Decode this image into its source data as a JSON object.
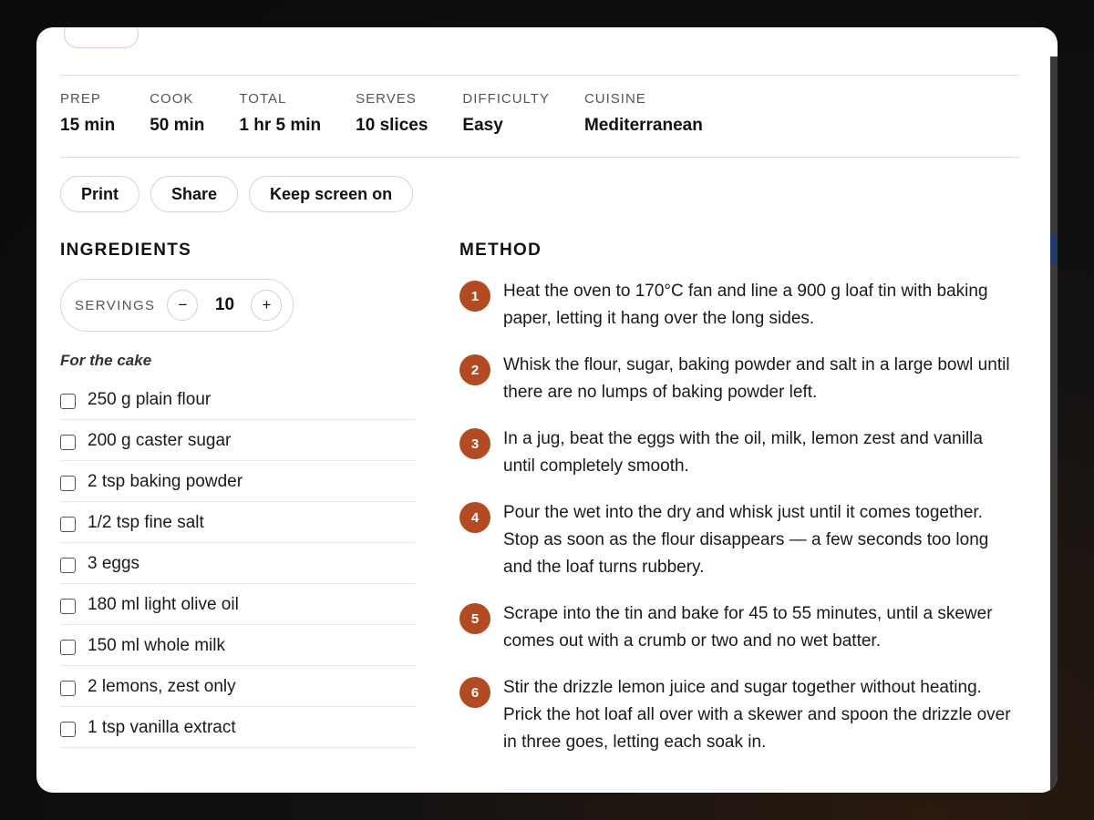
{
  "stats": [
    {
      "label": "PREP",
      "value": "15 min"
    },
    {
      "label": "COOK",
      "value": "50 min"
    },
    {
      "label": "TOTAL",
      "value": "1 hr 5 min"
    },
    {
      "label": "SERVES",
      "value": "10 slices"
    },
    {
      "label": "DIFFICULTY",
      "value": "Easy"
    },
    {
      "label": "CUISINE",
      "value": "Mediterranean"
    }
  ],
  "actions": {
    "print": "Print",
    "share": "Share",
    "keep_screen": "Keep screen on"
  },
  "ingredients": {
    "title": "INGREDIENTS",
    "servings_label": "SERVINGS",
    "servings_value": "10",
    "decrease": "−",
    "increase": "+",
    "group_title": "For the cake",
    "items": [
      "250 g plain flour",
      "200 g caster sugar",
      "2 tsp baking powder",
      "1/2 tsp fine salt",
      "3 eggs",
      "180 ml light olive oil",
      "150 ml whole milk",
      "2 lemons, zest only",
      "1 tsp vanilla extract"
    ]
  },
  "method": {
    "title": "METHOD",
    "steps": [
      {
        "num": "1",
        "text": "Heat the oven to 170°C fan and line a 900 g loaf tin with baking paper, letting it hang over the long sides."
      },
      {
        "num": "2",
        "text": "Whisk the flour, sugar, baking powder and salt in a large bowl until there are no lumps of baking powder left."
      },
      {
        "num": "3",
        "text": "In a jug, beat the eggs with the oil, milk, lemon zest and vanilla until completely smooth."
      },
      {
        "num": "4",
        "text": "Pour the wet into the dry and whisk just until it comes together. Stop as soon as the flour disappears — a few seconds too long and the loaf turns rubbery."
      },
      {
        "num": "5",
        "text": "Scrape into the tin and bake for 45 to 55 minutes, until a skewer comes out with a crumb or two and no wet batter."
      },
      {
        "num": "6",
        "text": "Stir the drizzle lemon juice and sugar together without heating. Prick the hot loaf all over with a skewer and spoon the drizzle over in three goes, letting each soak in."
      }
    ]
  },
  "colors": {
    "accent": "#b24a22",
    "background": "#0b0b0b",
    "card": "#ffffff"
  }
}
